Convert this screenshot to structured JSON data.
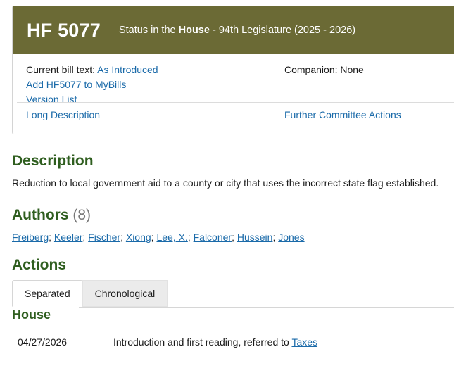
{
  "bill": {
    "id": "HF 5077",
    "status_prefix": "Status in the",
    "status_chamber": "House",
    "status_suffix": "- 94th Legislature (2025 - 2026)"
  },
  "info": {
    "current_bill_text_label": "Current bill text:",
    "current_bill_text_link": "As Introduced",
    "add_to_mybills": "Add HF5077 to MyBills",
    "version_list": "Version List",
    "companion": "Companion: None",
    "long_description": "Long Description",
    "further_actions": "Further Committee Actions"
  },
  "description": {
    "heading": "Description",
    "text": "Reduction to local government aid to a county or city that uses the incorrect state flag established."
  },
  "authors": {
    "heading": "Authors",
    "count": "(8)",
    "names": [
      "Freiberg",
      "Keeler",
      "Fischer",
      "Xiong",
      "Lee, X.",
      "Falconer",
      "Hussein",
      "Jones"
    ]
  },
  "actions": {
    "heading": "Actions",
    "tabs": [
      "Separated",
      "Chronological"
    ],
    "chamber": "House",
    "rows": [
      {
        "date": "04/27/2026",
        "text": "Introduction and first reading, referred to",
        "link": "Taxes"
      }
    ]
  },
  "colors": {
    "header_bg": "#6b6a35",
    "heading_green": "#2f5e1f",
    "link_blue": "#1a6aa9"
  }
}
